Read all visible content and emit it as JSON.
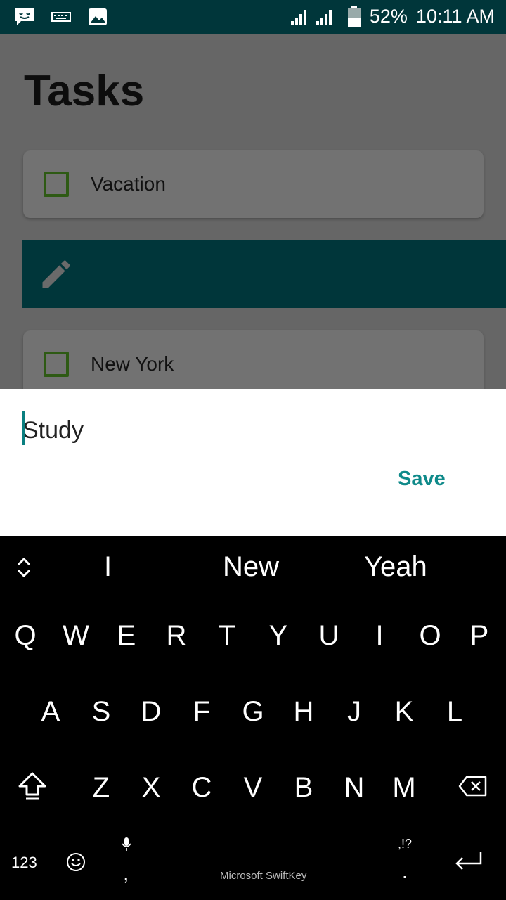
{
  "status_bar": {
    "battery": "52%",
    "time": "10:11 AM"
  },
  "app": {
    "title": "Tasks",
    "tasks": [
      {
        "label": "Vacation",
        "checked": false
      },
      {
        "label": "New York",
        "checked": false
      }
    ]
  },
  "dialog": {
    "input_value": "Study",
    "save_label": "Save"
  },
  "keyboard": {
    "suggestions": [
      "I",
      "New",
      "Yeah"
    ],
    "row1": [
      "Q",
      "W",
      "E",
      "R",
      "T",
      "Y",
      "U",
      "I",
      "O",
      "P"
    ],
    "row2": [
      "A",
      "S",
      "D",
      "F",
      "G",
      "H",
      "J",
      "K",
      "L"
    ],
    "row3": [
      "Z",
      "X",
      "C",
      "V",
      "B",
      "N",
      "M"
    ],
    "numbers_label": "123",
    "comma": ",",
    "period": ".",
    "punct": ",!?",
    "brand": "Microsoft SwiftKey"
  },
  "colors": {
    "status_bar": "#00363a",
    "accent": "#0f8a8a",
    "checkbox": "#2e5a14"
  }
}
